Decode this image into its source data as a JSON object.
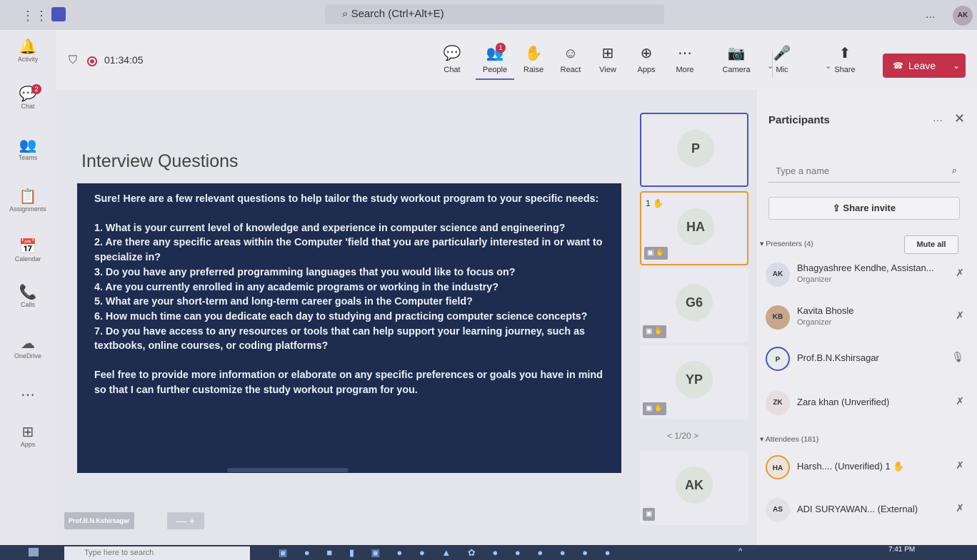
{
  "topbar": {
    "search_placeholder": "Search (Ctrl+Alt+E)",
    "more": "...",
    "avatar": "AK"
  },
  "rail": [
    {
      "icon": "bell-icon",
      "glyph": "🔔",
      "label": "Activity",
      "badge": ""
    },
    {
      "icon": "chat-icon",
      "glyph": "💬",
      "label": "Chat",
      "badge": "2"
    },
    {
      "icon": "teams-icon",
      "glyph": "👥",
      "label": "Teams",
      "badge": ""
    },
    {
      "icon": "assignments-icon",
      "glyph": "📋",
      "label": "Assignments",
      "badge": ""
    },
    {
      "icon": "calendar-icon",
      "glyph": "📅",
      "label": "Calendar",
      "badge": ""
    },
    {
      "icon": "calls-icon",
      "glyph": "📞",
      "label": "Calls",
      "badge": ""
    },
    {
      "icon": "onedrive-icon",
      "glyph": "☁",
      "label": "OneDrive",
      "badge": ""
    },
    {
      "icon": "more-apps-icon",
      "glyph": "⋯",
      "label": "",
      "badge": ""
    },
    {
      "icon": "apps-icon",
      "glyph": "⊞",
      "label": "Apps",
      "badge": ""
    }
  ],
  "meeting": {
    "timer": "01:34:05",
    "controls": [
      {
        "key": "chat",
        "label": "Chat",
        "glyph": "💬",
        "badge": ""
      },
      {
        "key": "people",
        "label": "People",
        "glyph": "👥",
        "badge": "1"
      },
      {
        "key": "raise",
        "label": "Raise",
        "glyph": "✋",
        "badge": ""
      },
      {
        "key": "react",
        "label": "React",
        "glyph": "☺",
        "badge": ""
      },
      {
        "key": "view",
        "label": "View",
        "glyph": "⊞",
        "badge": ""
      },
      {
        "key": "apps",
        "label": "Apps",
        "glyph": "⊕",
        "badge": ""
      },
      {
        "key": "more",
        "label": "More",
        "glyph": "⋯",
        "badge": ""
      },
      {
        "key": "camera",
        "label": "Camera",
        "glyph": "📷",
        "badge": ""
      },
      {
        "key": "mic",
        "label": "Mic",
        "glyph": "🎤",
        "badge": ""
      },
      {
        "key": "share",
        "label": "Share",
        "glyph": "⬆",
        "badge": ""
      }
    ],
    "leave_label": "Leave"
  },
  "slide": {
    "title": "Interview Questions",
    "lines": [
      "Sure! Here are a few relevant questions to help tailor the study workout program to your specific needs:",
      "",
      "1. What is your current level of knowledge and experience in computer science and engineering?",
      "2. Are there any specific areas within the Computer 'field that you are particularly interested in or want to",
      "specialize in?",
      "3. Do you have any preferred programming languages that you would like to focus on?",
      "4. Are you currently enrolled in any academic programs or working in the industry?",
      "5. What are your short-term and long-term career goals in the Computer field?",
      "6. How much time can you dedicate each day to studying and practicing computer science concepts?",
      "7. Do you have access to any resources or tools that can help support your learning journey, such as",
      "textbooks, online courses, or coding platforms?",
      "",
      "Feel free to provide more information or elaborate on any specific preferences or goals you have in mind",
      "so that I can further customize the study workout program for you."
    ],
    "presenter_tag": "Prof.B.N.Kshirsagar",
    "zoom_label": "—   +"
  },
  "tiles": [
    {
      "initials": "P",
      "state": "speaking",
      "hand": "",
      "icons": ""
    },
    {
      "initials": "HA",
      "state": "raised",
      "hand": "1 ✋",
      "icons": "▣ ✋"
    },
    {
      "initials": "G6",
      "state": "",
      "hand": "",
      "icons": "▣ ✋"
    },
    {
      "initials": "YP",
      "state": "",
      "hand": "",
      "icons": "▣ ✋"
    },
    {
      "initials": "AK",
      "state": "",
      "hand": "",
      "icons": "▣"
    }
  ],
  "pager": "<  1/20  >",
  "participants": {
    "title": "Participants",
    "more": "···",
    "close": "✕",
    "search_placeholder": "Type a name",
    "share_invite": "Share invite",
    "presenters_label": "▾ Presenters (4)",
    "mute_all": "Mute all",
    "attendees_label": "▾ Attendees (181)",
    "presenters": [
      {
        "initials": "AK",
        "name": "Bhagyashree Kendhe, Assistan...",
        "role": "Organizer",
        "color": "#d9dbe9"
      },
      {
        "initials": "KB",
        "name": "Kavita Bhosle",
        "role": "Organizer",
        "color": "#c8a78a"
      },
      {
        "initials": "P",
        "name": "Prof.B.N.Kshirsagar",
        "role": "",
        "color": "#e5ecea"
      },
      {
        "initials": "ZK",
        "name": "Zara khan (Unverified)",
        "role": "",
        "color": "#e7dde0"
      }
    ],
    "attendees": [
      {
        "initials": "HA",
        "name": "Harsh.... (Unverified)  1 ✋",
        "role": "",
        "color": "#ece4da"
      },
      {
        "initials": "AS",
        "name": "ADI SURYAWAN... (External)",
        "role": "",
        "color": "#e2e2e6"
      }
    ]
  },
  "taskbar": {
    "search_placeholder": "Type here to search",
    "time": "7:41 PM"
  }
}
